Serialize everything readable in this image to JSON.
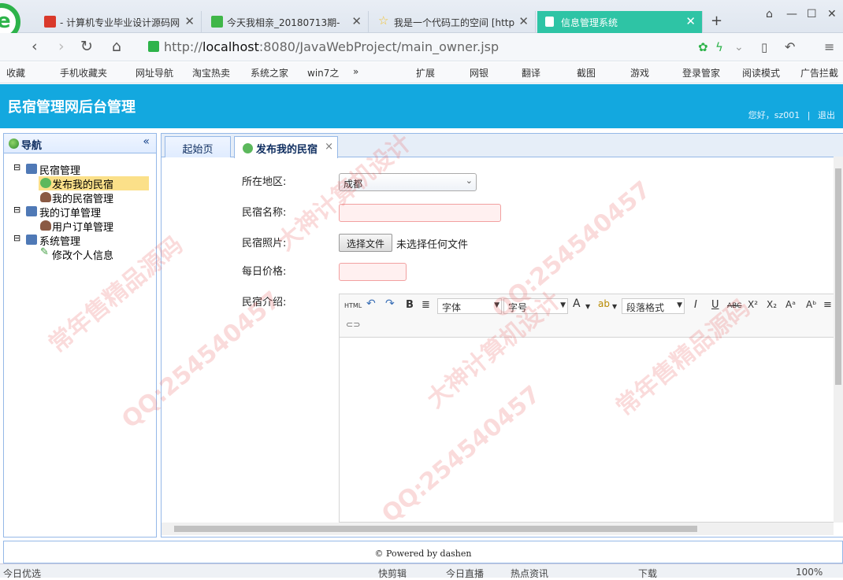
{
  "browser": {
    "tabs": [
      {
        "label": "- 计算机专业毕业设计源码网",
        "color": "#d9392b"
      },
      {
        "label": "今天我相亲_20180713期- ",
        "color": "#3fb648"
      },
      {
        "label": "我是一个代码工的空间 [http",
        "color": "#f2c230"
      },
      {
        "label": "信息管理系统",
        "color": "#ffffff"
      }
    ],
    "url_prefix": "http://",
    "url_host": "localhost",
    "url_rest": ":8080/JavaWebProject/main_owner.jsp",
    "bookmarks": [
      "收藏",
      "手机收藏夹",
      "网址导航",
      "淘宝热卖",
      "系统之家",
      "win7之",
      "»",
      "扩展",
      "网银",
      "翻译",
      "截图",
      "游戏",
      "登录管家",
      "阅读模式",
      "广告拦截"
    ]
  },
  "app": {
    "title": "民宿管理网后台管理",
    "greeting": "您好，sz001",
    "separator": "|",
    "logout": "退出"
  },
  "nav": {
    "title": "导航",
    "collapse": "«",
    "items": [
      {
        "label": "民宿管理"
      },
      {
        "label": "发布我的民宿"
      },
      {
        "label": "我的民宿管理"
      },
      {
        "label": "我的订单管理"
      },
      {
        "label": "用户订单管理"
      },
      {
        "label": "系统管理"
      },
      {
        "label": "修改个人信息"
      }
    ]
  },
  "center_tabs": [
    {
      "label": "起始页"
    },
    {
      "label": "发布我的民宿",
      "close": "×"
    }
  ],
  "form": {
    "region_label": "所在地区:",
    "region_value": "成都",
    "name_label": "民宿名称:",
    "photo_label": "民宿照片:",
    "file_button": "选择文件",
    "file_status": "未选择任何文件",
    "price_label": "每日价格:",
    "intro_label": "民宿介绍:"
  },
  "editor": {
    "html_btn": "HTML",
    "font_label": "字体",
    "size_label": "字号",
    "paragraph_label": "段落格式",
    "bold": "B",
    "italic": "I",
    "underline": "U",
    "strike": "ABC",
    "sup": "X²",
    "sub": "X₂",
    "fontcolor": "A"
  },
  "footer": {
    "text": "© Powered by dashen"
  },
  "statusbar": [
    "今日优选",
    "快剪辑",
    "今日直播",
    "热点资讯",
    "下载",
    "100%"
  ],
  "watermark": [
    "QQ:254540457",
    "常年售精品源码",
    "大神计算机设计"
  ]
}
